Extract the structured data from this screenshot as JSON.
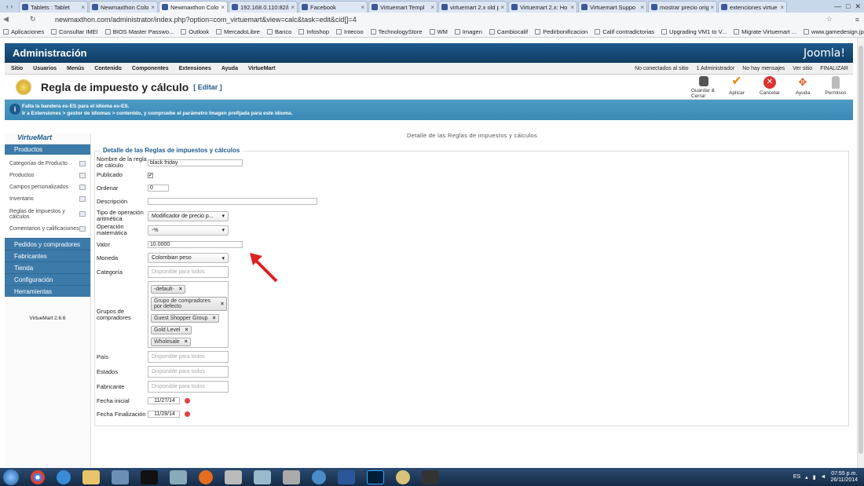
{
  "browser": {
    "tabs": [
      {
        "label": "Tablets : Tablet",
        "active": false
      },
      {
        "label": "Newmaxthon Colo",
        "active": false
      },
      {
        "label": "Newmaxthon Colo",
        "active": true
      },
      {
        "label": "192.168.0.110:82/in",
        "active": false
      },
      {
        "label": "Facebook",
        "active": false
      },
      {
        "label": "Virtuemart Templ",
        "active": false
      },
      {
        "label": "virtuemart 2.x old p",
        "active": false
      },
      {
        "label": "Virtuemart 2.x: Ho",
        "active": false
      },
      {
        "label": "Virtuemart Suppo",
        "active": false
      },
      {
        "label": "mostrar precio orig",
        "active": false
      },
      {
        "label": "extenciones virtue",
        "active": false
      }
    ],
    "url": "newmaxthon.com/administrator/index.php?option=com_virtuemart&view=calc&task=edit&cid[]=4",
    "bookmarks": [
      "Aplicaciones",
      "Consultar IMEI",
      "BIOS Master Passwo...",
      "Outlook",
      "MercadoLibre",
      "Banco",
      "Infoshop",
      "Intecoo",
      "TechnologyStore",
      "WM",
      "Imagen",
      "Cambiocalif",
      "Pedirbonificacion",
      "Calif contradictorias",
      "Upgrading VM1 to V...",
      "Migrate Virtuemart ...",
      "www.gamedesign.jp..."
    ]
  },
  "admin": {
    "title": "Administración",
    "logo": "Joomla!",
    "menu": [
      "Sitio",
      "Usuarios",
      "Menús",
      "Contenido",
      "Componentes",
      "Extensiones",
      "Ayuda",
      "VirtueMart"
    ],
    "status": [
      "No conectados al sitio",
      "1 Administrador",
      "No hay mensajes",
      "Ver sitio",
      "FINALIZAR"
    ],
    "page_title": "Regla de impuesto y cálculo",
    "page_title_suffix": "[ Editar ]",
    "toolbar": {
      "save_close": "Guardar & Cerrar",
      "apply": "Aplicar",
      "cancel": "Cancelar",
      "help": "Ayuda",
      "permissions": "Permisos"
    },
    "message_line1": "Falta la bandera es-ES para el idioma es-ES.",
    "message_line2": "Ir a Extensiones > gestor de idiomas > contenido, y compruebe el parámetro Imagen prefijada para este idioma."
  },
  "sidebar": {
    "logo": "VirtueMart",
    "section": "Productos",
    "items": [
      "Categorías de Producto",
      "Productos",
      "Campos personalizados",
      "Inventario",
      "Reglas de impuestos y cálculos",
      "Comentarios y calificaciones"
    ],
    "categories": [
      "Pedidos y compradores",
      "Fabricantes",
      "Tienda",
      "Configuración",
      "Herramientas"
    ],
    "version": "VirtueMart 2.6.6"
  },
  "form": {
    "header": "Detalle de las Reglas de impuestos y cálculos",
    "legend": "Detalle de las Reglas de impuestos y cálculos",
    "labels": {
      "name": "Nombre de la regla de cálculo",
      "published": "Publicado",
      "ordering": "Ordenar",
      "description": "Descripción",
      "operation_type": "Tipo de operación aritmética",
      "math_op": "Operación matemática",
      "value": "Valor",
      "currency": "Moneda",
      "category": "Categoría",
      "shopper_groups": "Grupos de compradores",
      "country": "País",
      "states": "Estados",
      "manufacturer": "Fabricante",
      "start_date": "Fecha inicial",
      "end_date": "Fecha Finalización"
    },
    "values": {
      "name": "black friday",
      "published": "✔",
      "ordering": "0",
      "description": "",
      "operation_type": "Modificador de precio p...",
      "math_op": "-%",
      "value": "10.0000",
      "currency": "Colombian peso",
      "category_placeholder": "Disponible para todos",
      "shopper_groups": [
        "-default-",
        "Grupo de compradores por defecto",
        "Guest Shopper Group",
        "Gold Level",
        "Wholesale"
      ],
      "country_placeholder": "Disponible para todos",
      "states_placeholder": "Disponible para todos",
      "manufacturer_placeholder": "Disponible para todos",
      "start_date": "11/27/14",
      "end_date": "11/28/14"
    }
  },
  "taskbar": {
    "lang": "ES",
    "time": "07:55 p.m.",
    "date": "26/11/2014"
  },
  "colors": {
    "header_blue": "#1e5b8c",
    "msg_blue": "#3a89b6",
    "arrow_red": "#d22"
  }
}
